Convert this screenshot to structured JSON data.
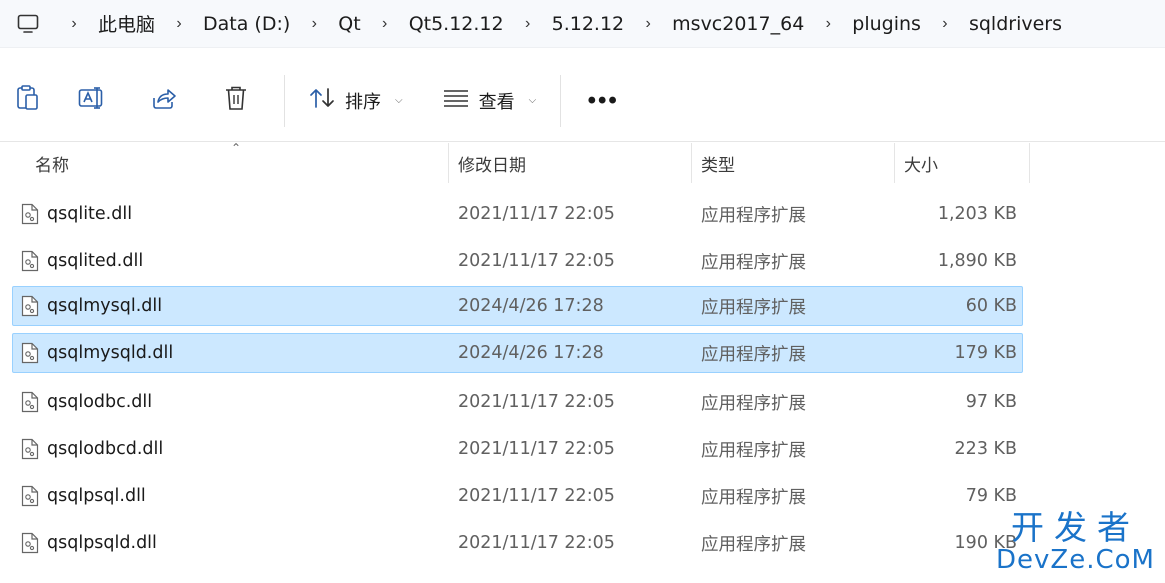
{
  "breadcrumb": {
    "items": [
      "此电脑",
      "Data (D:)",
      "Qt",
      "Qt5.12.12",
      "5.12.12",
      "msvc2017_64",
      "plugins",
      "sqldrivers"
    ]
  },
  "toolbar": {
    "sort_label": "排序",
    "view_label": "查看"
  },
  "columns": {
    "name": "名称",
    "date": "修改日期",
    "type": "类型",
    "size": "大小"
  },
  "files": [
    {
      "name": "qsqlite.dll",
      "date": "2021/11/17 22:05",
      "type": "应用程序扩展",
      "size": "1,203 KB",
      "selected": false
    },
    {
      "name": "qsqlited.dll",
      "date": "2021/11/17 22:05",
      "type": "应用程序扩展",
      "size": "1,890 KB",
      "selected": false
    },
    {
      "name": "qsqlmysql.dll",
      "date": "2024/4/26 17:28",
      "type": "应用程序扩展",
      "size": "60 KB",
      "selected": true
    },
    {
      "name": "qsqlmysqld.dll",
      "date": "2024/4/26 17:28",
      "type": "应用程序扩展",
      "size": "179 KB",
      "selected": true
    },
    {
      "name": "qsqlodbc.dll",
      "date": "2021/11/17 22:05",
      "type": "应用程序扩展",
      "size": "97 KB",
      "selected": false
    },
    {
      "name": "qsqlodbcd.dll",
      "date": "2021/11/17 22:05",
      "type": "应用程序扩展",
      "size": "223 KB",
      "selected": false
    },
    {
      "name": "qsqlpsql.dll",
      "date": "2021/11/17 22:05",
      "type": "应用程序扩展",
      "size": "79 KB",
      "selected": false
    },
    {
      "name": "qsqlpsqld.dll",
      "date": "2021/11/17 22:05",
      "type": "应用程序扩展",
      "size": "190 KB",
      "selected": false
    }
  ],
  "watermark": {
    "line1": "开发者",
    "line2": "DevZe.CoM"
  },
  "colors": {
    "selection_bg": "#cce8ff",
    "selection_border": "#99d1ff",
    "watermark": "#1a73c9"
  }
}
